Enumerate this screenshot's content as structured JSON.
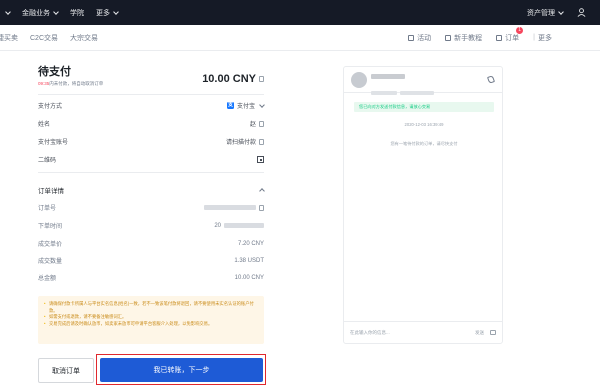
{
  "topnav": {
    "items": [
      "金融业务",
      "学院",
      "更多"
    ],
    "asset_mgmt": "资产管理"
  },
  "subnav": {
    "tabs": [
      "快捷买卖",
      "C2C交易",
      "大宗交易"
    ],
    "tools": [
      "活动",
      "新手教程",
      "订单",
      "更多"
    ],
    "order_badge": "1"
  },
  "order": {
    "title": "待支付",
    "countdown_time": "09:35",
    "countdown_text": "内未付款，将自动取消订单",
    "amount": "10.00 CNY"
  },
  "payment": {
    "method_label": "支付方式",
    "method_value": "支付宝",
    "name_label": "姓名",
    "name_value": "赵",
    "account_label": "支付宝账号",
    "account_value": "请扫描付款",
    "qr_label": "二维码"
  },
  "details": {
    "title": "订单详情",
    "order_no_label": "订单号",
    "time_label": "下单时间",
    "time_value": "20",
    "price_label": "成交单价",
    "price_value": "7.20 CNY",
    "qty_label": "成交数量",
    "qty_value": "1.38 USDT",
    "total_label": "总金额",
    "total_value": "10.00 CNY"
  },
  "notice": {
    "lines": [
      "请确保付款卡所属人与平台实名信息(姓名)一致，若不一致该笔付款将退回，请不要使用未实名认证的账户付款。",
      "如需支付或退款，请不要备注敏感词汇。",
      "交易完成后请及时确认放币，如卖家未放币可申请平台客服介入处理，以免影响交易。"
    ]
  },
  "buttons": {
    "cancel": "取消订单",
    "confirm": "我已转账，下一步"
  },
  "chat": {
    "notice": "您已向对方发送付款信息，请放心交易",
    "timestamp": "2020-12-03 16:39:49",
    "system_msg": "您有一笔待付款的订单，请尽快支付",
    "input_placeholder": "在此输入你的信息...",
    "send": "发送"
  },
  "colors": {
    "primary": "#1e5bd6",
    "highlight": "#e0282e",
    "nav_bg": "#151a26"
  }
}
